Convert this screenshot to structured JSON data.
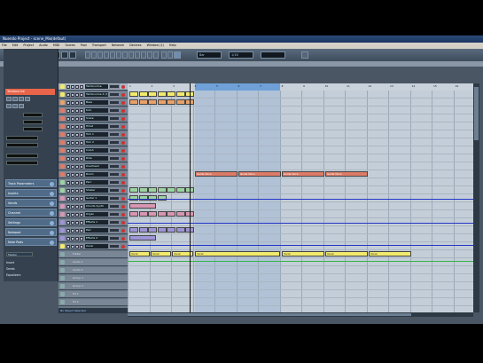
{
  "window": {
    "title": "Nuendo Project - scene_Mix(defaut)"
  },
  "menubar": {
    "items": [
      "File",
      "Edit",
      "Project",
      "Audio",
      "MIDI",
      "Scores",
      "Pool",
      "Transport",
      "Network",
      "Devices",
      "Window (1)",
      "Help"
    ]
  },
  "infoline": {
    "text": "No Object Selected"
  },
  "toolbar": {
    "quantize_value": "Bar",
    "snap_value": "1/16",
    "color_value": ""
  },
  "inspector": {
    "track_name": "Tambourine",
    "sections": [
      "Track Parameters",
      "Inserts",
      "Sends",
      "Channel",
      "Settings",
      "Notepad",
      "Note Pads"
    ],
    "lower_sections": [
      "Insert",
      "Sends",
      "Equalizers"
    ],
    "lower_select": "Master"
  },
  "tracks": [
    {
      "name": "Tambourine",
      "color": "#f2ea6c"
    },
    {
      "name": "Tambourine 2 (1)",
      "color": "#f2ea6c"
    },
    {
      "name": "Bass",
      "color": "#e9a16a"
    },
    {
      "name": "Kick",
      "color": "#de7b66"
    },
    {
      "name": "Snare",
      "color": "#de7b66"
    },
    {
      "name": "Hihat",
      "color": "#de7b66"
    },
    {
      "name": "Tom 1",
      "color": "#de7b66"
    },
    {
      "name": "Tom 2",
      "color": "#de7b66"
    },
    {
      "name": "Crash",
      "color": "#de7b66"
    },
    {
      "name": "Ride",
      "color": "#de7b66"
    },
    {
      "name": "Overhead",
      "color": "#de7b66"
    },
    {
      "name": "Room",
      "color": "#de7b66"
    },
    {
      "name": "Perc",
      "color": "#9bd3a1"
    },
    {
      "name": "Shaker",
      "color": "#9bd3a1"
    },
    {
      "name": "Guitar 1",
      "color": "#d796b2"
    },
    {
      "name": "Chords Synth",
      "color": "#d796b2"
    },
    {
      "name": "Organ",
      "color": "#d796b2"
    },
    {
      "name": "Effects 1",
      "color": "#9d95d6"
    },
    {
      "name": "Pad",
      "color": "#9d95d6"
    },
    {
      "name": "Effects 2",
      "color": "#9d95d6"
    },
    {
      "name": "Vocal",
      "color": "#f2ea6c"
    },
    {
      "name": "Folder",
      "color": "#8aa"
    },
    {
      "name": "Audio 1",
      "color": "#8aa"
    },
    {
      "name": "Audio 2",
      "color": "#8aa"
    },
    {
      "name": "Group 1",
      "color": "#8aa"
    },
    {
      "name": "Group 2",
      "color": "#8aa"
    },
    {
      "name": "FX 1",
      "color": "#8aa"
    },
    {
      "name": "FX 2",
      "color": "#8aa"
    }
  ],
  "ruler": {
    "ticks": [
      "1",
      "2",
      "3",
      "4",
      "5",
      "6",
      "7",
      "8",
      "9",
      "10",
      "11",
      "12",
      "13",
      "14",
      "15",
      "16"
    ]
  },
  "parts": [
    {
      "label": "Tamb",
      "color": "yel"
    },
    {
      "label": "Tamb",
      "color": "org"
    },
    {
      "label": "Guide Voice",
      "color": "red"
    },
    {
      "label": "Vocal",
      "color": "yel"
    }
  ],
  "transport": {
    "text": "No Object Selected"
  },
  "colors": {
    "accent": "#e8654a",
    "loop": "#6fa0d8",
    "background": "#4a5664"
  }
}
